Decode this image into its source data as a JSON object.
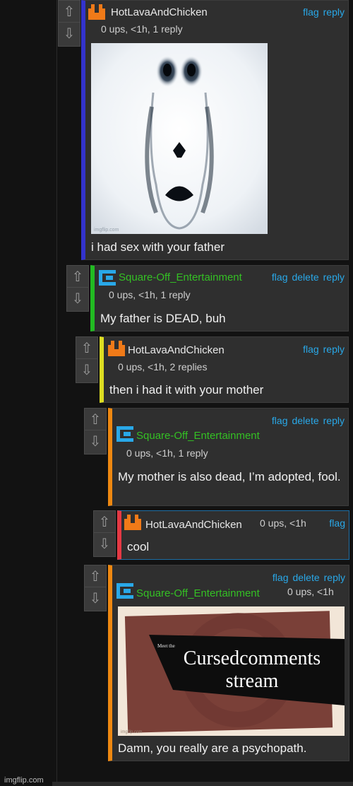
{
  "ui": {
    "up_arrow": "⇧",
    "down_arrow": "⇩",
    "flag": "flag",
    "delete": "delete",
    "reply": "reply"
  },
  "colors": {
    "link": "#29a8e8",
    "user_orange": "#e8e8e8",
    "user_green": "#34c024",
    "depth": [
      "#3333cc",
      "#22bb22",
      "#dddd22",
      "#ee8811",
      "#e53944",
      "#ee8811"
    ]
  },
  "comments": [
    {
      "user": "HotLavaAndChicken",
      "meta": "0 ups, <1h, 1 reply",
      "text": "i had sex with your father",
      "avatar_icon": "imgflip-orange-avatar-icon"
    },
    {
      "user": "Square-Off_Entertainment",
      "meta": "0 ups, <1h, 1 reply",
      "text": "My father is DEAD, buh",
      "avatar_icon": "imgflip-blue-avatar-icon"
    },
    {
      "user": "HotLavaAndChicken",
      "meta": "0 ups, <1h, 2 replies",
      "text": "then i had it with your mother",
      "avatar_icon": "imgflip-orange-avatar-icon"
    },
    {
      "user": "Square-Off_Entertainment",
      "meta": "0 ups, <1h, 1 reply",
      "text": "My mother is also dead, I’m adopted, fool.",
      "avatar_icon": "imgflip-blue-avatar-icon"
    },
    {
      "user": "HotLavaAndChicken",
      "meta": "0 ups, <1h",
      "text": "cool",
      "avatar_icon": "imgflip-orange-avatar-icon"
    },
    {
      "user": "Square-Off_Entertainment",
      "meta": "0 ups, <1h",
      "text": "Damn, you really are a psychopath.",
      "avatar_icon": "imgflip-blue-avatar-icon"
    }
  ],
  "image1": {
    "watermark": "imgflip.com"
  },
  "image2": {
    "small_text": "Meet the",
    "title": "Cursedcomments stream",
    "watermark": "imgflip.com"
  },
  "footer": {
    "watermark": "imgflip.com"
  }
}
